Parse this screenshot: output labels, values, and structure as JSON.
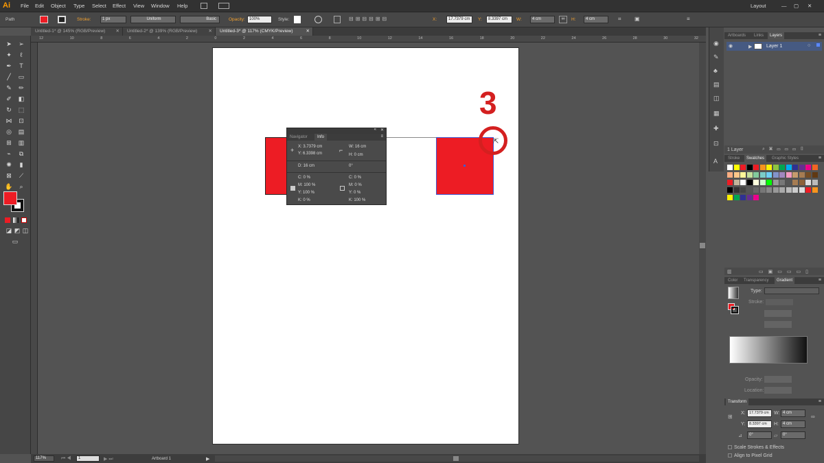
{
  "app": {
    "logo": "Ai",
    "workspace": "Layout"
  },
  "menu": [
    "File",
    "Edit",
    "Object",
    "Type",
    "Select",
    "Effect",
    "View",
    "Window",
    "Help"
  ],
  "control": {
    "selection": "Path",
    "stroke_label": "Stroke:",
    "stroke_value": "1 px",
    "uniform": "Uniform",
    "basic": "Basic",
    "opacity_label": "Opacity:",
    "opacity_value": "100%",
    "style_label": "Style:",
    "x_label": "X:",
    "x_value": "17.7379 cm",
    "y_label": "Y:",
    "y_value": "8.3397 cm",
    "w_label": "W:",
    "w_value": "4 cm",
    "h_label": "H:",
    "h_value": "4 cm"
  },
  "tabs": [
    {
      "label": "Untitled-1* @ 145% (RGB/Preview)"
    },
    {
      "label": "Untitled-2* @ 139% (RGB/Preview)"
    },
    {
      "label": "Untitled-3* @ 117% (CMYK/Preview)"
    }
  ],
  "ruler_ticks": [
    "12",
    "10",
    "8",
    "6",
    "4",
    "2",
    "0",
    "2",
    "4",
    "6",
    "8",
    "10",
    "12",
    "14",
    "16",
    "18",
    "20",
    "22",
    "24",
    "26",
    "28",
    "30",
    "32"
  ],
  "annotation": {
    "number": "3"
  },
  "info_panel": {
    "tab_navigator": "Navigator",
    "tab_info": "Info",
    "x": "X: 3.7379 cm",
    "y": "Y: 6.3398 cm",
    "w": "W: 16 cm",
    "h": "H: 0 cm",
    "d": "D: 16 cm",
    "angle": "0°",
    "c1": "C: 0 %",
    "m1": "M: 100 %",
    "y1": "Y: 100 %",
    "k1": "K: 0 %",
    "c2": "C: 0 %",
    "m2": "M: 0 %",
    "y2": "Y: 0 %",
    "k2": "K: 100 %"
  },
  "layers_panel": {
    "tabs": [
      "Artboards",
      "Links",
      "Layers"
    ],
    "layer_name": "Layer 1",
    "footer": "1 Layer"
  },
  "swatches_panel": {
    "tabs": [
      "Stroke",
      "Swatches",
      "Graphic Styles"
    ]
  },
  "gradient_panel": {
    "tabs": [
      "Color",
      "Transparency",
      "Gradient"
    ],
    "type_label": "Type:",
    "stroke_label": "Stroke:",
    "opacity_label": "Opacity:",
    "location_label": "Location:"
  },
  "transform_panel": {
    "title": "Transform",
    "x_label": "X:",
    "x_value": "17.7379 cm",
    "y_label": "Y:",
    "y_value": "8.3397 cm",
    "w_label": "W:",
    "w_value": "4 cm",
    "h_label": "H:",
    "h_value": "4 cm",
    "angle_value": "0°",
    "shear_value": "0°",
    "scale_strokes": "Scale Strokes & Effects",
    "align_pixel": "Align to Pixel Grid"
  },
  "status": {
    "zoom": "117%",
    "artboard_num": "1",
    "artboard_label": "Artboard 1"
  },
  "colors": {
    "fill": "#ed1c24",
    "accent": "#d42020"
  }
}
